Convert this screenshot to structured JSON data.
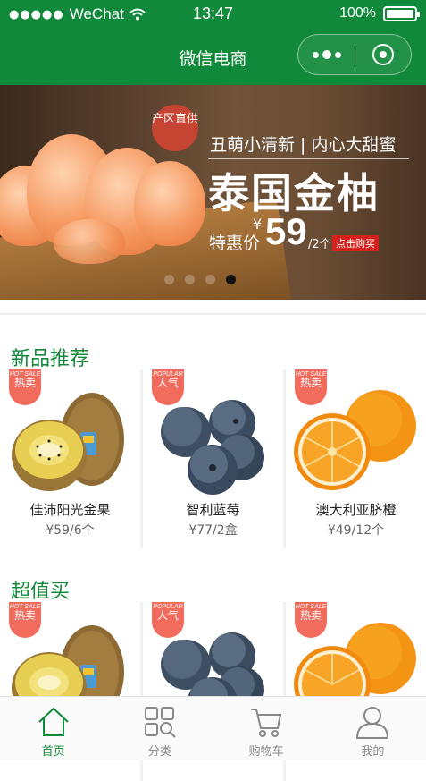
{
  "status": {
    "carrier": "WeChat",
    "time": "13:47",
    "battery": "100%"
  },
  "nav": {
    "title": "微信电商"
  },
  "banner": {
    "seal": "产区直供",
    "slogan": "丑萌小清新 | 内心大甜蜜",
    "title": "泰国金柚",
    "price_label": "特惠价",
    "currency": "¥",
    "price": "59",
    "unit": "/2个",
    "buy": "点击购买",
    "slide_count": 4,
    "active_slide": 4
  },
  "sections": [
    {
      "title": "新品推荐",
      "products": [
        {
          "tag_en": "HOT SALE",
          "tag": "热卖",
          "name": "佳沛阳光金果",
          "price": "¥59/6个",
          "fruit": "kiwi"
        },
        {
          "tag_en": "POPULAR",
          "tag": "人气",
          "name": "智利蓝莓",
          "price": "¥77/2盒",
          "fruit": "blueberry"
        },
        {
          "tag_en": "HOT SALE",
          "tag": "热卖",
          "name": "澳大利亚脐橙",
          "price": "¥49/12个",
          "fruit": "orange"
        }
      ]
    },
    {
      "title": "超值买",
      "products": [
        {
          "tag_en": "HOT SALE",
          "tag": "热卖",
          "fruit": "kiwi"
        },
        {
          "tag_en": "POPULAR",
          "tag": "人气",
          "fruit": "blueberry"
        },
        {
          "tag_en": "HOT SALE",
          "tag": "热卖",
          "fruit": "orange"
        }
      ]
    }
  ],
  "tabbar": [
    {
      "label": "首页",
      "icon": "home-icon",
      "active": true
    },
    {
      "label": "分类",
      "icon": "category-icon",
      "active": false
    },
    {
      "label": "购物车",
      "icon": "cart-icon",
      "active": false
    },
    {
      "label": "我的",
      "icon": "profile-icon",
      "active": false
    }
  ],
  "colors": {
    "brand": "#11893a",
    "tag": "#f26c5e",
    "buy": "#d3211c"
  }
}
